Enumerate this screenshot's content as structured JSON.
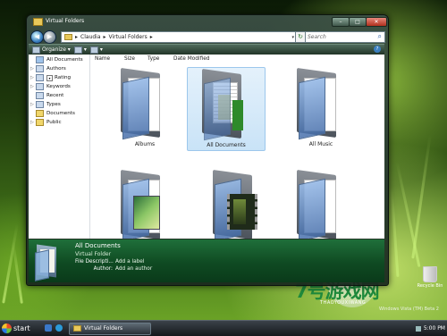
{
  "window": {
    "title": "Virtual Folders"
  },
  "address": {
    "segments": [
      "Claudia",
      "Virtual Folders"
    ],
    "separator": "▸"
  },
  "search": {
    "placeholder": "Search"
  },
  "toolbar": {
    "organize": "Organize ▾",
    "views": "▾"
  },
  "sidebar": {
    "items": [
      {
        "label": "All Documents",
        "selected": true
      },
      {
        "label": "Authors"
      },
      {
        "label": "Rating"
      },
      {
        "label": "Keywords"
      },
      {
        "label": "Recent"
      },
      {
        "label": "Types"
      },
      {
        "label": "Documents"
      },
      {
        "label": "Public"
      }
    ]
  },
  "columns": [
    "Name",
    "Size",
    "Type",
    "Date Modified"
  ],
  "folders": [
    {
      "label": "Albums",
      "kind": "photos"
    },
    {
      "label": "All Documents",
      "kind": "documents",
      "selected": true
    },
    {
      "label": "All Music",
      "kind": "plain"
    },
    {
      "label": "",
      "kind": "photos2"
    },
    {
      "label": "",
      "kind": "video"
    },
    {
      "label": "",
      "kind": "plain2"
    }
  ],
  "details": {
    "title": "All Documents",
    "subtitle": "Virtual Folder",
    "rows": [
      {
        "key": "File Descripti...",
        "value": "Add a label"
      },
      {
        "key": "Author:",
        "value": "Add an author"
      }
    ]
  },
  "desktop": {
    "recycle_bin": "Recycle Bin",
    "version_note": "Windows Vista (TM) Beta 2",
    "watermark": "7号游戏网",
    "watermark_sub": "THAOYOUXIWANG"
  },
  "taskbar": {
    "start": "start",
    "task": "Virtual Folders",
    "time": "5:00 PM"
  },
  "colors": {
    "accent": "#1f6f3a",
    "selection": "#c9e3f7",
    "titlebar": "#3c5246"
  }
}
